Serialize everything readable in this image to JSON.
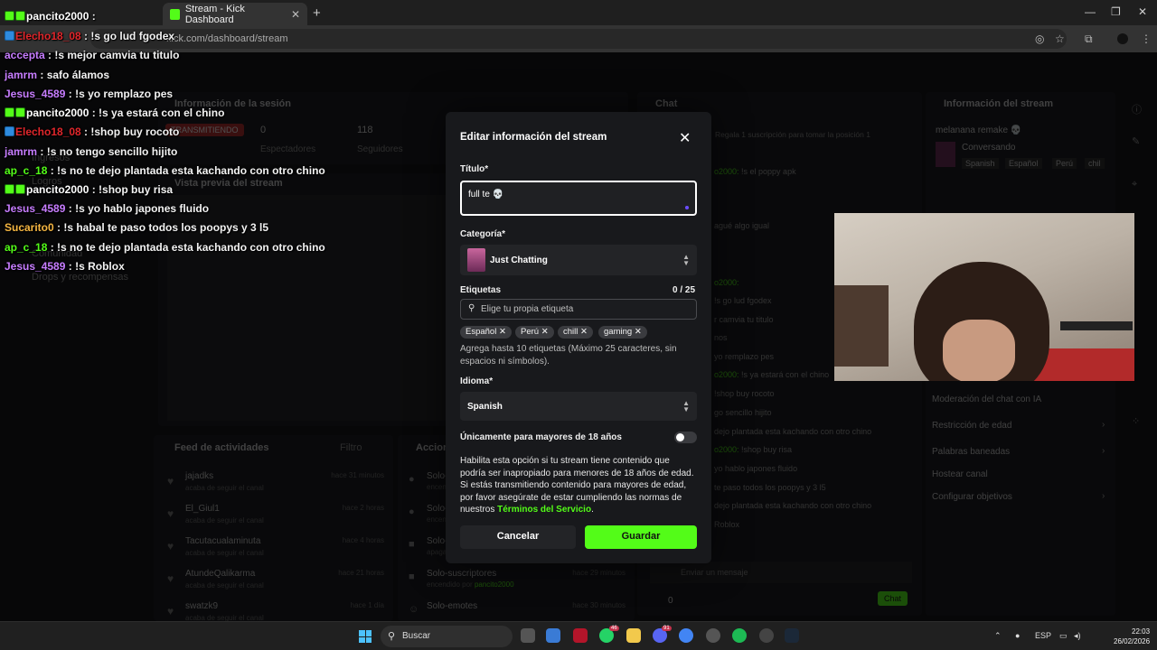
{
  "browser": {
    "active_tab_title": "Stream - Kick Dashboard",
    "url": "kick.com/dashboard/stream"
  },
  "dashboard": {
    "session_title": "Información de la sesión",
    "status_badge": "TRANSMITIENDO",
    "viewers_value": "0",
    "viewers_label": "Espectadores",
    "followers_value": "118",
    "followers_label": "Seguidores",
    "preview_title": "Vista previa del stream",
    "sidebar_items": [
      "Ingresos",
      "Logros",
      "Comunidad",
      "Drops y recompensas"
    ],
    "feed_title": "Feed de actividades",
    "feed_filter": "Filtro",
    "actions_title": "Acciones",
    "feed": [
      {
        "name": "jajadks",
        "sub": "acaba de seguir el canal",
        "time": "hace 31 minutos"
      },
      {
        "name": "El_Giul1",
        "sub": "acaba de seguir el canal",
        "time": "hace 2 horas"
      },
      {
        "name": "Tacutacualaminuta",
        "sub": "acaba de seguir el canal",
        "time": "hace 4 horas"
      },
      {
        "name": "AtundeQalikarma",
        "sub": "acaba de seguir el canal",
        "time": "hace 21 horas"
      },
      {
        "name": "swatzk9",
        "sub": "acaba de seguir el canal",
        "time": "hace 1 día"
      }
    ],
    "actions": [
      {
        "name": "Solo-",
        "sub": "encendi",
        "time": ""
      },
      {
        "name": "Solo-",
        "sub": "encendi",
        "time": ""
      },
      {
        "name": "Solo-",
        "sub": "apaga",
        "time": ""
      },
      {
        "name": "Solo-suscriptores",
        "sub_prefix": "encendido por ",
        "sub_user": "pancito2000",
        "time": "hace 29 minutos"
      },
      {
        "name": "Solo-emotes",
        "sub_prefix": "",
        "sub_user": "",
        "time": "hace 30 minutos"
      }
    ],
    "chat_title": "Chat",
    "chat_pinned": "Regala 1 suscripción para tomar la posición 1",
    "chat_lines": [
      {
        "user": "o2000:",
        "text": " !s el poppy apk"
      },
      {
        "user": "",
        "text": "agué algo igual"
      },
      {
        "user": "o2000:",
        "text": ""
      },
      {
        "user": "",
        "text": "!s go lud fgodex"
      },
      {
        "user": "",
        "text": "r camvia tu titulo"
      },
      {
        "user": "",
        "text": "nos"
      },
      {
        "user": "",
        "text": "yo remplazo pes"
      },
      {
        "user": "o2000:",
        "text": " !s ya estará con el chino"
      },
      {
        "user": "",
        "text": "!shop buy rocoto"
      },
      {
        "user": "",
        "text": "go sencillo hijito"
      },
      {
        "user": "",
        "text": "dejo plantada esta kachando con otro chino"
      },
      {
        "user": "o2000:",
        "text": " !shop buy risa"
      },
      {
        "user": "",
        "text": "yo hablo japones fluido"
      },
      {
        "user": "",
        "text": "te paso todos los poopys y 3 l5"
      },
      {
        "user": "",
        "text": "dejo plantada esta kachando con otro chino"
      },
      {
        "user": "",
        "text": "Roblox"
      }
    ],
    "chat_input_placeholder": "Enviar un mensaje",
    "chat_button": "Chat",
    "chat_points": "0",
    "stream_info_title": "Información del stream",
    "stream_title": "melanana remake 💀",
    "stream_category": "Conversando",
    "stream_tags": [
      "Spanish",
      "Español",
      "Perú",
      "chil"
    ],
    "settings_rows": [
      "Moderación del chat con IA",
      "Restricción de edad",
      "Palabras baneadas",
      "Hostear canal",
      "Configurar objetivos"
    ]
  },
  "overlay_chat": [
    {
      "user": "pancito2000",
      "text": " : ",
      "color": "#ffffff",
      "badge": "green"
    },
    {
      "user": "Elecho18_08",
      "text": " : !s go lud fgodex",
      "color": "#e0262b",
      "badge": "blue"
    },
    {
      "user": "accepta",
      "text": " : !s mejor camvia tu titulo",
      "color": "#c77dff",
      "badge": ""
    },
    {
      "user": "jamrm",
      "text": " : safo álamos",
      "color": "#c77dff",
      "badge": ""
    },
    {
      "user": "Jesus_4589",
      "text": " : !s yo remplazo pes",
      "color": "#c77dff",
      "badge": ""
    },
    {
      "user": "pancito2000",
      "text": " : !s ya estará con el chino",
      "color": "#ffffff",
      "badge": "green"
    },
    {
      "user": "Elecho18_08",
      "text": " : !shop buy rocoto",
      "color": "#e0262b",
      "badge": "blue"
    },
    {
      "user": "jamrm",
      "text": " : !s no tengo sencillo hijito",
      "color": "#c77dff",
      "badge": ""
    },
    {
      "user": "ap_c_18",
      "text": " : !s no te dejo plantada esta kachando con otro chino",
      "color": "#53fc18",
      "badge": ""
    },
    {
      "user": "pancito2000",
      "text": " : !shop buy risa",
      "color": "#ffffff",
      "badge": "green"
    },
    {
      "user": "Jesus_4589",
      "text": " : !s yo hablo japones fluido",
      "color": "#c77dff",
      "badge": ""
    },
    {
      "user": "Sucarito0",
      "text": " : !s habal te paso todos los poopys y 3 l5",
      "color": "#f5b642",
      "badge": ""
    },
    {
      "user": "ap_c_18",
      "text": " : !s no te dejo plantada esta kachando con otro chino",
      "color": "#53fc18",
      "badge": ""
    },
    {
      "user": "Jesus_4589",
      "text": " : !s Roblox",
      "color": "#c77dff",
      "badge": ""
    }
  ],
  "modal": {
    "title": "Editar información del stream",
    "title_label": "Título*",
    "title_value": "full te 💀",
    "category_label": "Categoría*",
    "category_value": "Just Chatting",
    "tags_label": "Etiquetas",
    "tags_count": "0 / 25",
    "tags_placeholder": "Elige tu propia etiqueta",
    "tags": [
      "Español",
      "Perú",
      "chill",
      "gaming"
    ],
    "tags_help": "Agrega hasta 10 etiquetas (Máximo 25 caracteres, sin espacios ni símbolos).",
    "language_label": "Idioma*",
    "language_value": "Spanish",
    "adult_label": "Únicamente para mayores de 18 años",
    "adult_enabled": false,
    "adult_desc": "Habilita esta opción si tu stream tiene contenido que podría ser inapropiado para menores de 18 años de edad. Si estás transmitiendo contenido para mayores de edad, por favor asegúrate de estar cumpliendo las normas de nuestros ",
    "terms_link": "Términos del Servicio",
    "terms_suffix": ".",
    "cancel_label": "Cancelar",
    "save_label": "Guardar"
  },
  "taskbar": {
    "search_label": "Buscar",
    "whatsapp_badge": "46",
    "discord_badge": "91",
    "lang": "ESP",
    "time": "22:03",
    "date": "26/02/2026"
  },
  "colors": {
    "kick_green": "#53fc18",
    "modal_bg": "#18191c",
    "page_bg": "#0b0b0c"
  }
}
